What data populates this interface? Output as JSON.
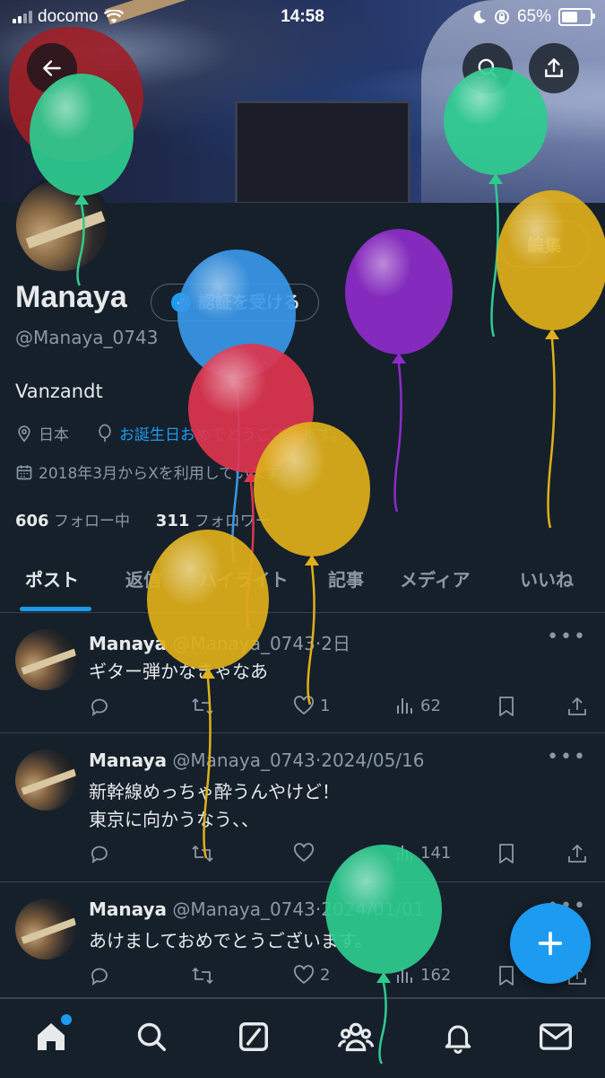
{
  "status_bar": {
    "carrier": "docomo",
    "time": "14:58",
    "battery": "65%",
    "battery_level": 0.65
  },
  "profile": {
    "name": "Manaya",
    "verify_label": "認証を受ける",
    "handle": "@Manaya_0743",
    "edit_label": "編集",
    "bio": "Vanzandt",
    "location": "日本",
    "birthday": "お誕生日おめでとうございます。",
    "joined": "2018年3月からXを利用しています",
    "following_count": "606",
    "following_label": "フォロー中",
    "followers_count": "311",
    "followers_label": "フォロワー"
  },
  "tabs": [
    "ポスト",
    "返信",
    "ハイライト",
    "記事",
    "メディア",
    "いいね"
  ],
  "posts": [
    {
      "name": "Manaya",
      "handle": "@Manaya_0743",
      "time": "·2日",
      "text": "ギター弾かなきゃなあ",
      "likes": "1",
      "views": "62",
      "replies": "",
      "reposts": ""
    },
    {
      "name": "Manaya",
      "handle": "@Manaya_0743",
      "time": "·2024/05/16",
      "text": "新幹線めっちゃ酔うんやけど！\n東京に向かうなう、、",
      "likes": "",
      "views": "141",
      "replies": "",
      "reposts": ""
    },
    {
      "name": "Manaya",
      "handle": "@Manaya_0743",
      "time": "·2024/01/01",
      "text": "あけましておめでとうございます。",
      "likes": "2",
      "views": "162",
      "replies": "",
      "reposts": ""
    }
  ],
  "colors": {
    "accent": "#1d9bf0",
    "background": "#15202b",
    "muted": "#8b98a5"
  },
  "balloon_colors": [
    "#2ecc8f",
    "#2ecc8f",
    "#e0b01a",
    "#8e2bc9",
    "#3a97e8",
    "#e0354f",
    "#e0b01a",
    "#e0b01a",
    "#2ecc8f"
  ],
  "icons": [
    "back-arrow-icon",
    "search-icon",
    "share-icon",
    "location-icon",
    "balloon-icon",
    "calendar-icon",
    "reply-icon",
    "repost-icon",
    "like-icon",
    "views-icon",
    "bookmark-icon",
    "share-icon",
    "compose-plus-icon",
    "home-icon",
    "explore-icon",
    "grok-icon",
    "communities-icon",
    "notifications-icon",
    "messages-icon"
  ]
}
